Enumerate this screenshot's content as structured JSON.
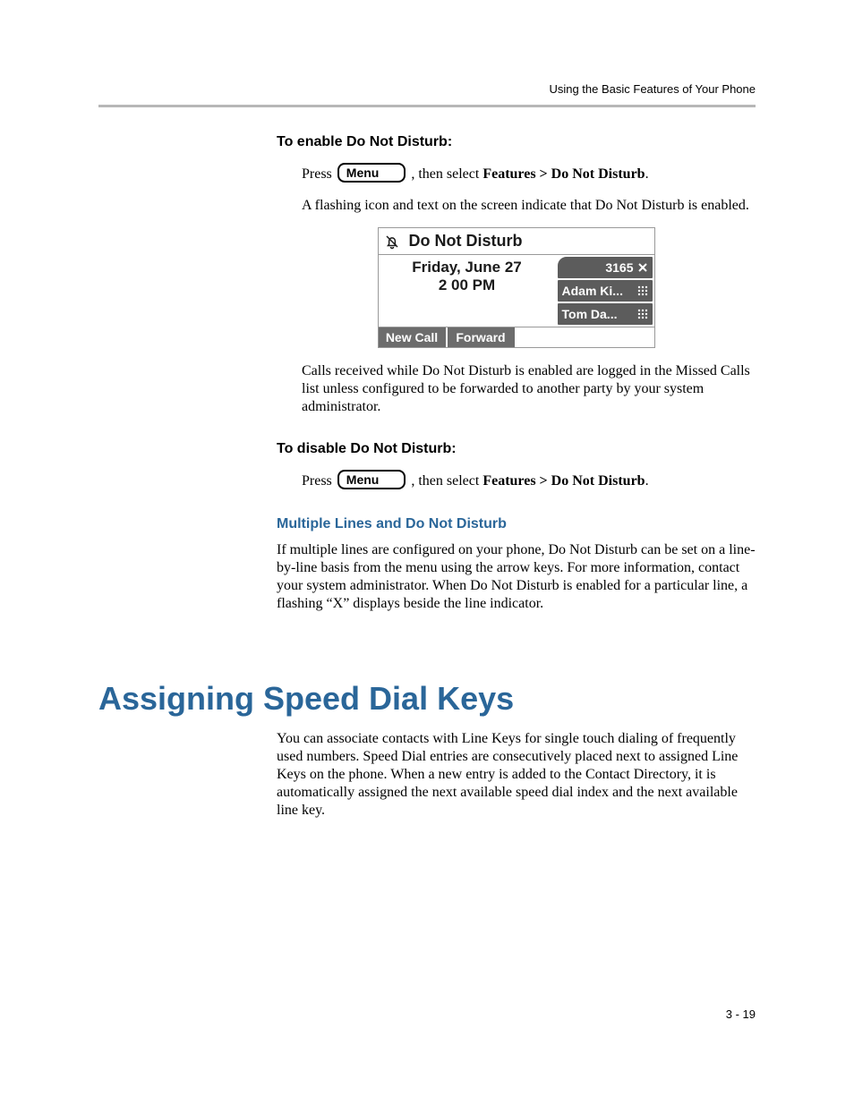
{
  "header": {
    "running_title": "Using the Basic Features of Your Phone"
  },
  "sections": {
    "enable_dnd_title": "To enable Do Not Disturb:",
    "enable_step_prefix": "Press",
    "menu_key_label": "Menu",
    "enable_step_suffix": ", then select",
    "enable_step_path": "Features > Do Not Disturb",
    "enable_note": "A flashing icon and text on the screen indicate that Do Not Disturb is enabled.",
    "missed_note": "Calls received while Do Not Disturb is enabled are logged in the Missed Calls list unless configured to be forwarded to another party by your system administrator.",
    "disable_dnd_title": "To disable Do Not Disturb:",
    "disable_step_prefix": "Press",
    "disable_step_suffix": ", then select",
    "disable_step_path": "Features > Do Not Disturb",
    "multi_title": "Multiple Lines and Do Not Disturb",
    "multi_body": "If multiple lines are configured on your phone, Do Not Disturb can be set on a line-by-line basis from the menu using the arrow keys. For more information, contact your system administrator. When Do Not Disturb is enabled for a particular line, a flashing “X” displays beside the line indicator.",
    "h1": "Assigning Speed Dial Keys",
    "speed_body": "You can associate contacts with Line Keys for single touch dialing of frequently used numbers. Speed Dial entries are consecutively placed next to assigned Line Keys on the phone. When a new entry is added to the Contact Directory, it is automatically assigned the next available speed dial index and the next available line key."
  },
  "phone": {
    "title": "Do Not Disturb",
    "date": "Friday, June 27",
    "time": "2 00 PM",
    "line1": "3165",
    "line2": "Adam Ki...",
    "line3": "Tom Da...",
    "softkeys": [
      "New Call",
      "Forward"
    ]
  },
  "footer": {
    "page_number": "3 - 19"
  }
}
